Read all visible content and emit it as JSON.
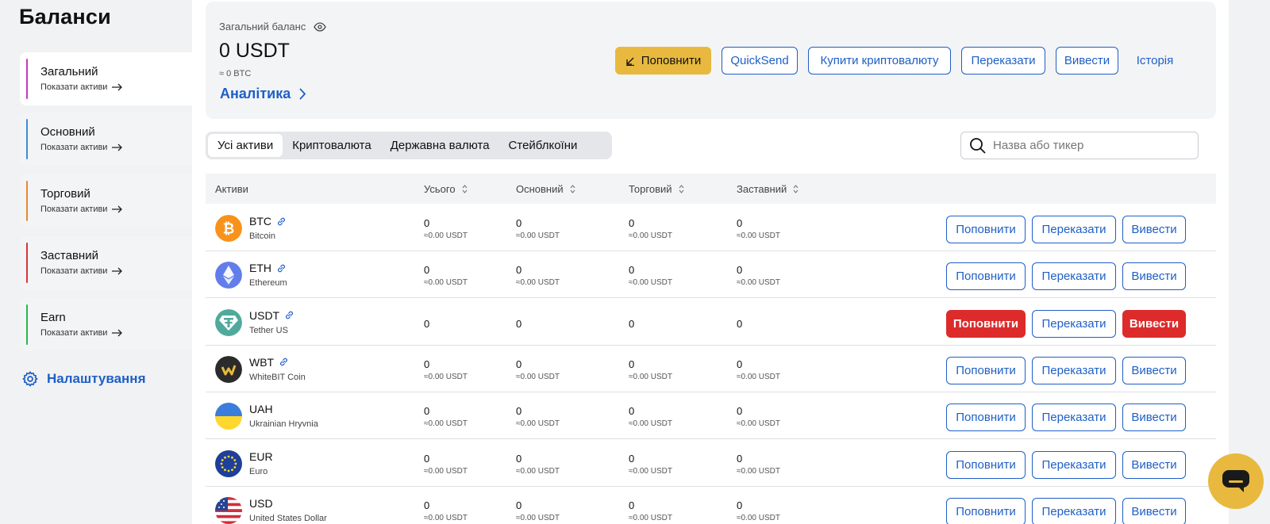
{
  "page_title": "Баланси",
  "sidebar": {
    "items": [
      {
        "label": "Загальний",
        "sub": "Показати активи",
        "color": "#c23bc4",
        "active": true
      },
      {
        "label": "Основний",
        "sub": "Показати активи",
        "color": "#3d8ed1",
        "active": false
      },
      {
        "label": "Торговий",
        "sub": "Показати активи",
        "color": "#e58a2f",
        "active": false
      },
      {
        "label": "Заставний",
        "sub": "Показати активи",
        "color": "#d3353a",
        "active": false
      },
      {
        "label": "Earn",
        "sub": "Показати активи",
        "color": "#2bb44f",
        "active": false
      }
    ],
    "settings_label": "Налаштування"
  },
  "balance": {
    "label": "Загальний баланс",
    "amount": "0 USDT",
    "btc": "≈ 0 BTC",
    "analytics_label": "Аналітика"
  },
  "actions": {
    "deposit": "Поповнити",
    "quicksend": "QuickSend",
    "buy_crypto": "Купити криптовалюту",
    "transfer": "Переказати",
    "withdraw": "Вивести",
    "history": "Історія"
  },
  "tabs": [
    "Усі активи",
    "Криптовалюта",
    "Державна валюта",
    "Стейблкоїни"
  ],
  "search": {
    "placeholder": "Назва або тикер"
  },
  "table": {
    "headers": {
      "assets": "Активи",
      "total": "Усього",
      "main": "Основний",
      "trading": "Торговий",
      "collateral": "Заставний"
    },
    "row_buttons": {
      "deposit": "Поповнити",
      "transfer": "Переказати",
      "withdraw": "Вивести"
    },
    "rows": [
      {
        "ticker": "BTC",
        "name": "Bitcoin",
        "icon": "bitcoin-icon",
        "link": true,
        "total": "0",
        "total_usdt": "≈0.00 USDT",
        "main": "0",
        "main_usdt": "≈0.00 USDT",
        "trading": "0",
        "trading_usdt": "≈0.00 USDT",
        "collateral": "0",
        "collateral_usdt": "≈0.00 USDT"
      },
      {
        "ticker": "ETH",
        "name": "Ethereum",
        "icon": "ethereum-icon",
        "link": true,
        "total": "0",
        "total_usdt": "≈0.00 USDT",
        "main": "0",
        "main_usdt": "≈0.00 USDT",
        "trading": "0",
        "trading_usdt": "≈0.00 USDT",
        "collateral": "0",
        "collateral_usdt": "≈0.00 USDT"
      },
      {
        "ticker": "USDT",
        "name": "Tether US",
        "icon": "tether-icon",
        "link": true,
        "total": "0",
        "main": "0",
        "trading": "0",
        "collateral": "0"
      },
      {
        "ticker": "WBT",
        "name": "WhiteBIT Coin",
        "icon": "whitebit-icon",
        "link": true,
        "total": "0",
        "total_usdt": "≈0.00 USDT",
        "main": "0",
        "main_usdt": "≈0.00 USDT",
        "trading": "0",
        "trading_usdt": "≈0.00 USDT",
        "collateral": "0",
        "collateral_usdt": "≈0.00 USDT"
      },
      {
        "ticker": "UAH",
        "name": "Ukrainian Hryvnia",
        "icon": "ukraine-flag-icon",
        "link": false,
        "total": "0",
        "total_usdt": "≈0.00 USDT",
        "main": "0",
        "main_usdt": "≈0.00 USDT",
        "trading": "0",
        "trading_usdt": "≈0.00 USDT",
        "collateral": "0",
        "collateral_usdt": "≈0.00 USDT"
      },
      {
        "ticker": "EUR",
        "name": "Euro",
        "icon": "eu-flag-icon",
        "link": false,
        "total": "0",
        "total_usdt": "≈0.00 USDT",
        "main": "0",
        "main_usdt": "≈0.00 USDT",
        "trading": "0",
        "trading_usdt": "≈0.00 USDT",
        "collateral": "0",
        "collateral_usdt": "≈0.00 USDT"
      },
      {
        "ticker": "USD",
        "name": "United States Dollar",
        "icon": "us-flag-icon",
        "link": false,
        "total": "0",
        "total_usdt": "≈0.00 USDT",
        "main": "0",
        "main_usdt": "≈0.00 USDT",
        "trading": "0",
        "trading_usdt": "≈0.00 USDT",
        "collateral": "0",
        "collateral_usdt": "≈0.00 USDT"
      }
    ]
  },
  "colors": {
    "accent": "#1f5fc6",
    "primary_yellow": "#e8b93e",
    "danger_red": "#dd2b2b"
  },
  "chat_icon": "chat-bubble-icon"
}
